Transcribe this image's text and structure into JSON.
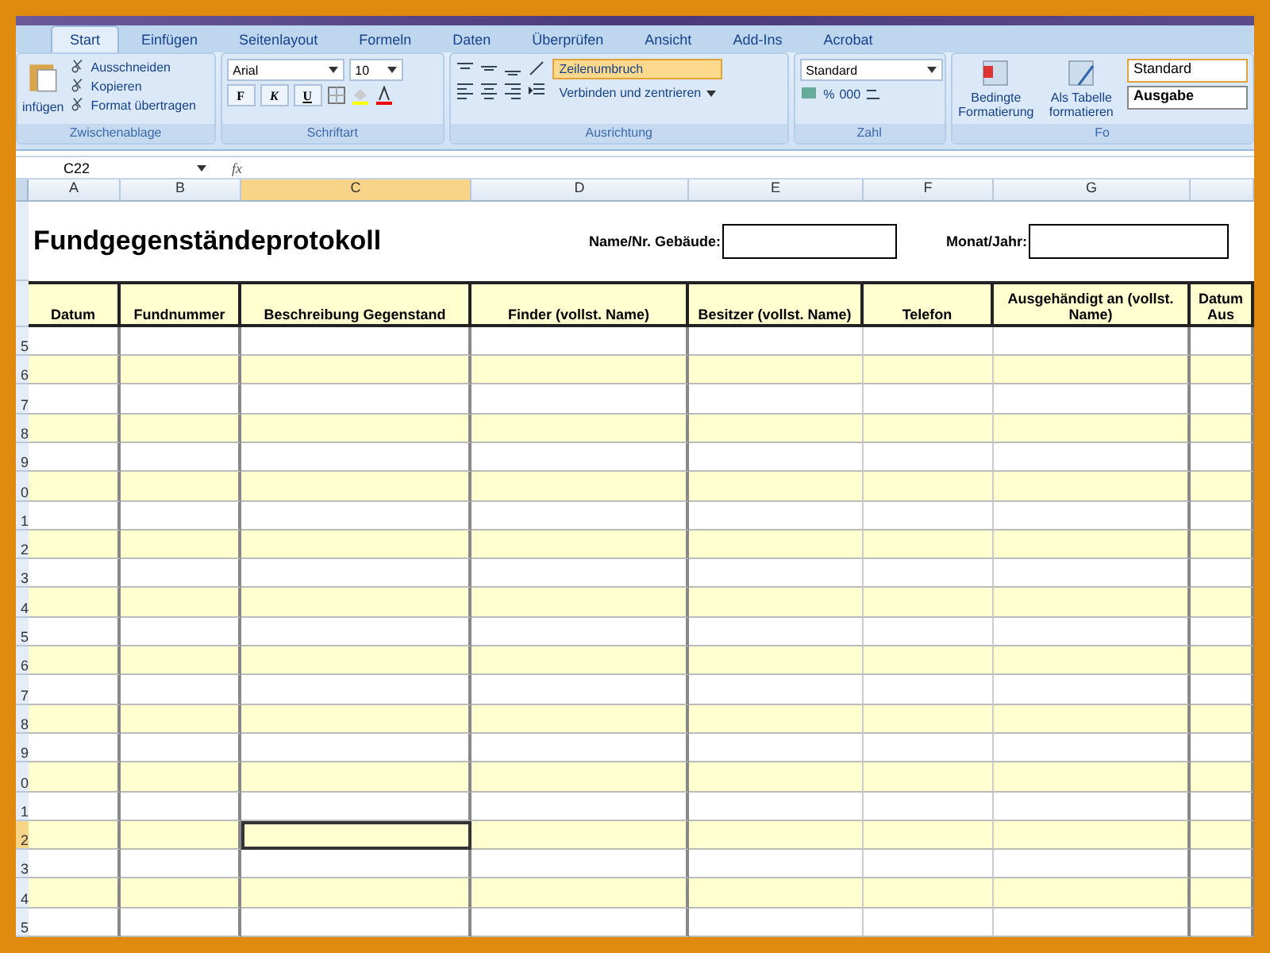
{
  "ribbon": {
    "tabs": [
      {
        "label": "Start",
        "selected": true
      },
      {
        "label": "Einfügen",
        "selected": false
      },
      {
        "label": "Seitenlayout",
        "selected": false
      },
      {
        "label": "Formeln",
        "selected": false
      },
      {
        "label": "Daten",
        "selected": false
      },
      {
        "label": "Überprüfen",
        "selected": false
      },
      {
        "label": "Ansicht",
        "selected": false
      },
      {
        "label": "Add-Ins",
        "selected": false
      },
      {
        "label": "Acrobat",
        "selected": false
      }
    ],
    "clipboard": {
      "paste": "infügen",
      "items": [
        "Ausschneiden",
        "Kopieren",
        "Format übertragen"
      ],
      "group": "Zwischenablage"
    },
    "font": {
      "name": "Arial",
      "size": "10",
      "styles": [
        "F",
        "K",
        "U"
      ],
      "group": "Schriftart"
    },
    "alignment": {
      "wrap": {
        "label": "Zeilenumbruch",
        "on": true
      },
      "merge": "Verbinden und zentrieren",
      "group": "Ausrichtung"
    },
    "number": {
      "format": "Standard",
      "percent": "%",
      "thousands": "000",
      "group": "Zahl"
    },
    "styles": {
      "conditional": "Bedingte Formatierung",
      "as_table": "Als Tabelle formatieren",
      "cells": [
        "Standard",
        "Ausgabe"
      ],
      "group": "Fo"
    }
  },
  "formula_bar": {
    "name_box": "C22",
    "fx": "fx"
  },
  "sheet": {
    "columns": [
      {
        "label": "A",
        "selected": false
      },
      {
        "label": "B",
        "selected": false
      },
      {
        "label": "C",
        "selected": true
      },
      {
        "label": "D",
        "selected": false
      },
      {
        "label": "E",
        "selected": false
      },
      {
        "label": "F",
        "selected": false
      },
      {
        "label": "G",
        "selected": false
      }
    ],
    "title": "Fundgegenständeprotokoll",
    "building_label": "Name/Nr. Gebäude:",
    "month_label": "Monat/Jahr:",
    "headers": [
      "Datum",
      "Fundnummer",
      "Beschreibung Gegenstand",
      "Finder (vollst. Name)",
      "Besitzer (vollst. Name)",
      "Telefon",
      "Ausgehändigt an (vollst. Name)",
      "Datum Aus"
    ],
    "rows": [
      {
        "label": "5",
        "selected": false
      },
      {
        "label": "6",
        "selected": false
      },
      {
        "label": "7",
        "selected": false
      },
      {
        "label": "8",
        "selected": false
      },
      {
        "label": "9",
        "selected": false
      },
      {
        "label": "0",
        "selected": false
      },
      {
        "label": "1",
        "selected": false
      },
      {
        "label": "2",
        "selected": false
      },
      {
        "label": "3",
        "selected": false
      },
      {
        "label": "4",
        "selected": false
      },
      {
        "label": "5",
        "selected": false
      },
      {
        "label": "6",
        "selected": false
      },
      {
        "label": "7",
        "selected": false
      },
      {
        "label": "8",
        "selected": false
      },
      {
        "label": "9",
        "selected": false
      },
      {
        "label": "0",
        "selected": false
      },
      {
        "label": "1",
        "selected": false
      },
      {
        "label": "2",
        "selected": true
      },
      {
        "label": "3",
        "selected": false
      },
      {
        "label": "4",
        "selected": false
      },
      {
        "label": "5",
        "selected": false
      }
    ]
  }
}
